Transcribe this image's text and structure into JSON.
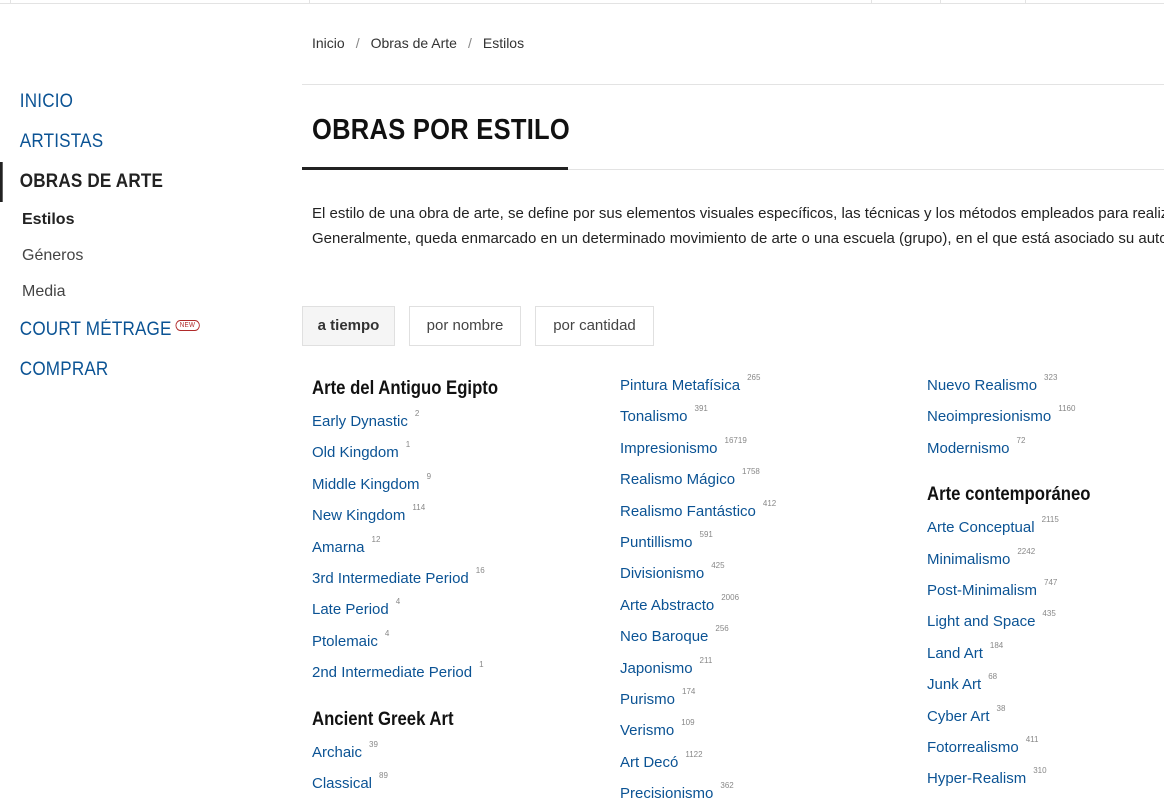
{
  "sidebar": {
    "items": [
      {
        "label": "INICIO"
      },
      {
        "label": "ARTISTAS"
      },
      {
        "label": "OBRAS DE ARTE"
      },
      {
        "label": "Estilos"
      },
      {
        "label": "Géneros"
      },
      {
        "label": "Media"
      },
      {
        "label": "COURT MÉTRAGE",
        "badge": "NEW"
      },
      {
        "label": "COMPRAR"
      }
    ]
  },
  "breadcrumb": [
    "Inicio",
    "Obras de Arte",
    "Estilos"
  ],
  "page": {
    "title": "OBRAS POR ESTILO",
    "intro": "El estilo de una obra de arte, se define por sus elementos visuales específicos, las técnicas y los métodos empleados para realizarlo. Generalmente, queda enmarcado en un determinado movimiento de arte o una escuela (grupo), en el que está asociado su autor."
  },
  "sort": {
    "buttons": [
      "a tiempo",
      "por nombre",
      "por cantidad"
    ],
    "active": "a tiempo"
  },
  "columns": [
    {
      "groups": [
        {
          "title": "Arte del Antiguo Egipto",
          "items": [
            {
              "name": "Early Dynastic",
              "count": "2"
            },
            {
              "name": "Old Kingdom",
              "count": "1"
            },
            {
              "name": "Middle Kingdom",
              "count": "9"
            },
            {
              "name": "New Kingdom",
              "count": "114"
            },
            {
              "name": "Amarna",
              "count": "12"
            },
            {
              "name": "3rd Intermediate Period",
              "count": "16"
            },
            {
              "name": "Late Period",
              "count": "4"
            },
            {
              "name": "Ptolemaic",
              "count": "4"
            },
            {
              "name": "2nd Intermediate Period",
              "count": "1"
            }
          ]
        },
        {
          "title": "Ancient Greek Art",
          "items": [
            {
              "name": "Archaic",
              "count": "39"
            },
            {
              "name": "Classical",
              "count": "89"
            }
          ]
        }
      ]
    },
    {
      "groups": [
        {
          "title": "",
          "items": [
            {
              "name": "Pintura Metafísica",
              "count": "265"
            },
            {
              "name": "Tonalismo",
              "count": "391"
            },
            {
              "name": "Impresionismo",
              "count": "16719"
            },
            {
              "name": "Realismo Mágico",
              "count": "1758"
            },
            {
              "name": "Realismo Fantástico",
              "count": "412"
            },
            {
              "name": "Puntillismo",
              "count": "591"
            },
            {
              "name": "Divisionismo",
              "count": "425"
            },
            {
              "name": "Arte Abstracto",
              "count": "2006"
            },
            {
              "name": "Neo Baroque",
              "count": "256"
            },
            {
              "name": "Japonismo",
              "count": "211"
            },
            {
              "name": "Purismo",
              "count": "174"
            },
            {
              "name": "Verismo",
              "count": "109"
            },
            {
              "name": "Art Decó",
              "count": "1122"
            },
            {
              "name": "Precisionismo",
              "count": "362"
            }
          ]
        }
      ]
    },
    {
      "groups": [
        {
          "title": "",
          "items": [
            {
              "name": "Nuevo Realismo",
              "count": "323"
            },
            {
              "name": "Neoimpresionismo",
              "count": "1160"
            },
            {
              "name": "Modernismo",
              "count": "72"
            }
          ]
        },
        {
          "title": "Arte contemporáneo",
          "items": [
            {
              "name": "Arte Conceptual",
              "count": "2115"
            },
            {
              "name": "Minimalismo",
              "count": "2242"
            },
            {
              "name": "Post-Minimalism",
              "count": "747"
            },
            {
              "name": "Light and Space",
              "count": "435"
            },
            {
              "name": "Land Art",
              "count": "184"
            },
            {
              "name": "Junk Art",
              "count": "68"
            },
            {
              "name": "Cyber Art",
              "count": "38"
            },
            {
              "name": "Fotorrealismo",
              "count": "411"
            },
            {
              "name": "Hyper-Realism",
              "count": "310"
            }
          ]
        }
      ]
    }
  ]
}
